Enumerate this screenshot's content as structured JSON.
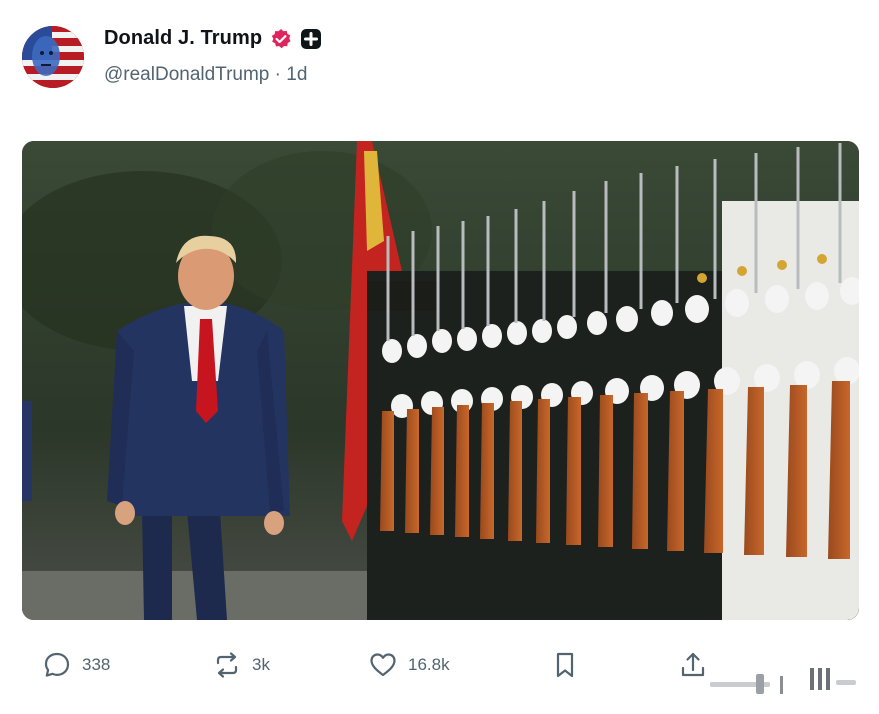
{
  "author": {
    "display_name": "Donald J. Trump",
    "handle": "@realDonaldTrump",
    "time_separator": "·",
    "time": "1d",
    "verified_color": "#e0245e",
    "avatar_icon": "flag-face-avatar"
  },
  "media": {
    "alt_icon": "photo"
  },
  "actions": {
    "reply_count": "338",
    "repost_count": "3k",
    "like_count": "16.8k"
  },
  "colors": {
    "text_primary": "#0f1419",
    "text_secondary": "#536471",
    "badge_pink": "#e0245e"
  }
}
